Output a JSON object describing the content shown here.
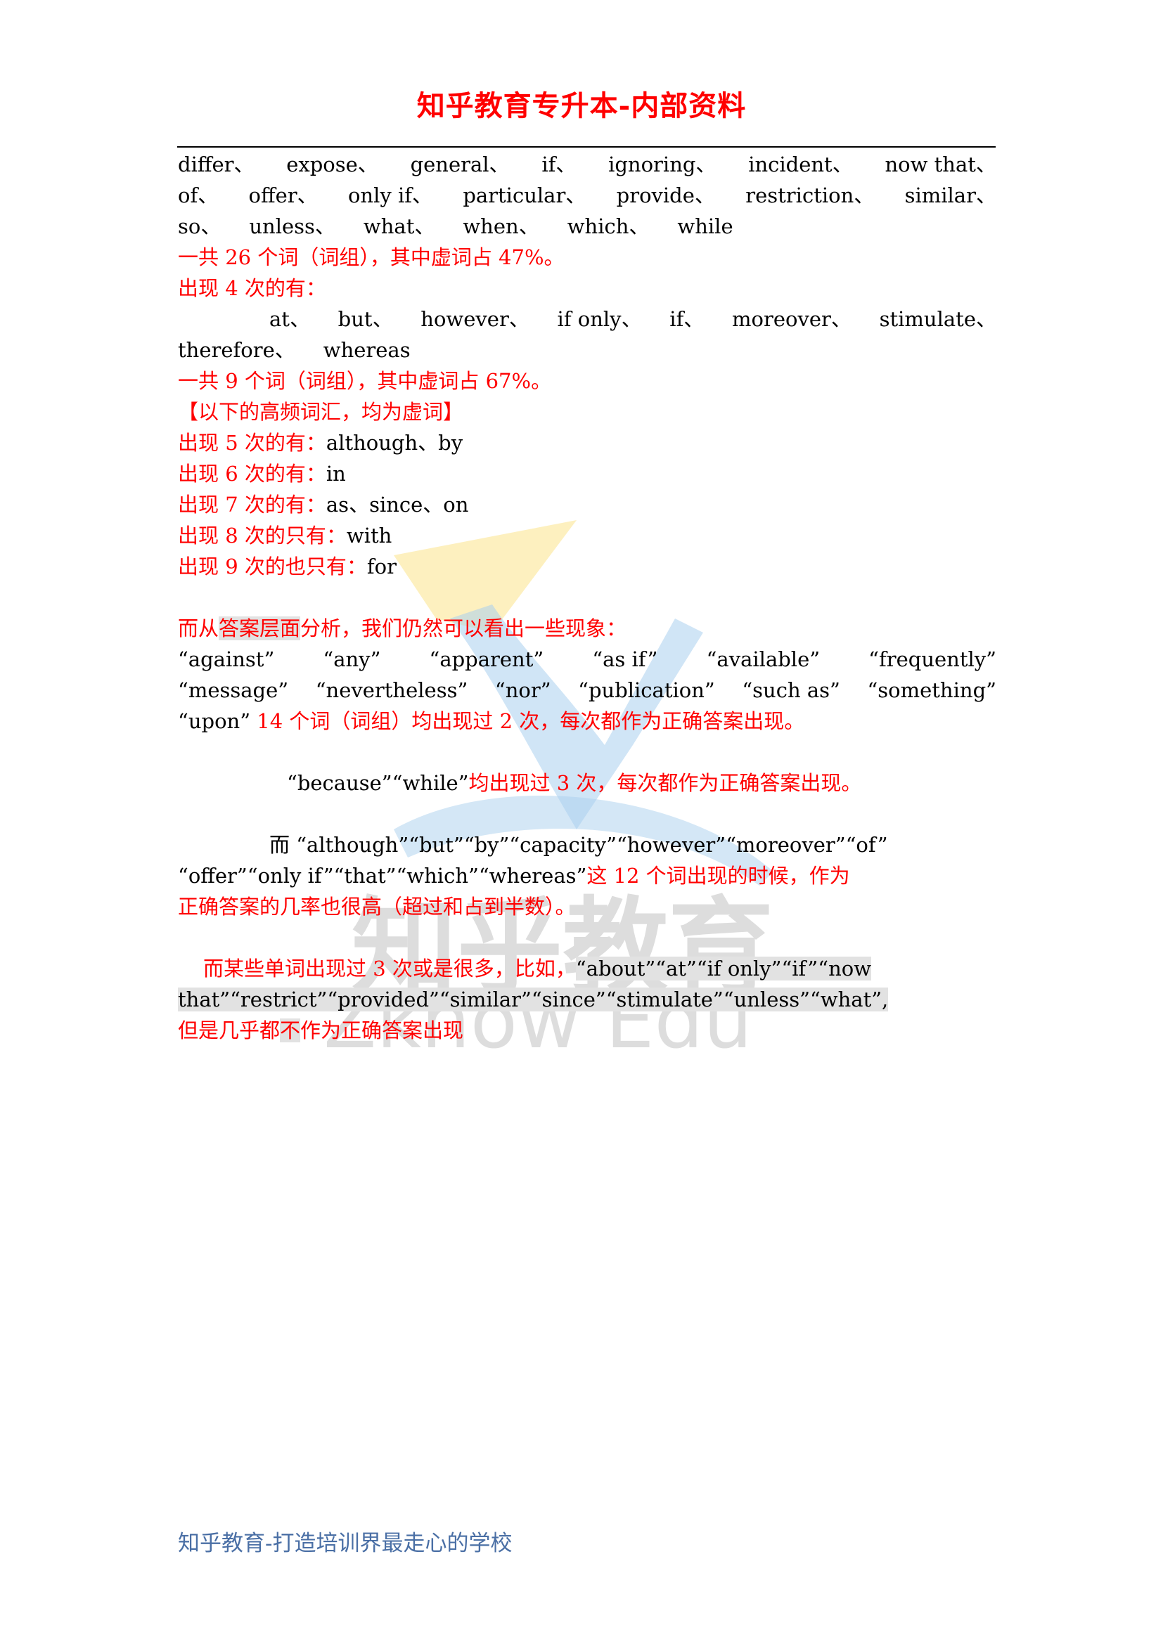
{
  "header": {
    "title": "知乎教育专升本-内部资料"
  },
  "section1": {
    "words_line1": [
      "differ、",
      "expose、",
      "general、",
      "if、",
      "ignoring、",
      "incident、",
      "now that、"
    ],
    "words_line2": [
      "of、",
      "offer、",
      "only if、",
      "particular、",
      "provide、",
      "restriction、",
      "similar、"
    ],
    "words_line3": [
      "so、",
      "unless、",
      "what、",
      "when、",
      "which、",
      "while"
    ],
    "summary": "一共 26 个词（词组），其中虚词占 47%。"
  },
  "section2": {
    "heading": "出现 4 次的有：",
    "words_line1": [
      "at、",
      "but、",
      "however、",
      "if only、",
      "if、",
      "moreover、",
      "stimulate、"
    ],
    "words_line2": [
      "therefore、",
      "whereas"
    ],
    "summary": "一共 9 个词（词组），其中虚词占 67%。"
  },
  "high_freq": {
    "heading": "【以下的高频词汇，均为虚词】",
    "rows": [
      {
        "label": "出现 5 次的有：",
        "words": "although、by"
      },
      {
        "label": "出现 6 次的有：",
        "words": "in"
      },
      {
        "label": "出现 7 次的有：",
        "words": "as、since、on"
      },
      {
        "label": "出现 8 次的只有：",
        "words": "with"
      },
      {
        "label": "出现 9 次的也只有：",
        "words": "for"
      }
    ]
  },
  "analysis": {
    "intro_pre": "而从",
    "intro_hl": "答案层面",
    "intro_post": "分析，我们仍然可以看出一些现象：",
    "twice_line1": [
      "“against”",
      "“any”",
      "“apparent”",
      "“as if”",
      "“available”",
      "“frequently”"
    ],
    "twice_line2": [
      "“message”",
      "“nevertheless”",
      "“nor”",
      "“publication”",
      "“such as”",
      "“something”"
    ],
    "twice_line3_word": "“upon”",
    "twice_line3_note": "14 个词（词组）均出现过 2 次，每次都作为正确答案出现。",
    "thrice_words": "“because”“while”",
    "thrice_note": "均出现过 3 次，每次都作为正确答案出现。",
    "high_lead": "而",
    "high_line1_words": "“although”“but”“by”“capacity”“however”“moreover”“of”",
    "high_line2_words": "“offer”“only if”“that”“which”“whereas”",
    "high_line2_note": "这 12 个词出现的时候，作为",
    "high_line3_note": "正确答案的几率也很高（超过和占到半数）。",
    "rare_intro": "而某些单词出现过 3 次或是很多，比如，",
    "rare_line1_words": "“about”“at”“if only”“if”“now",
    "rare_line2_words": "that”“restrict”“provided”“similar”“since”“stimulate”“unless”“what”,",
    "rare_line3_a": "但是几乎都",
    "rare_line3_hl": "不",
    "rare_line3_b": "作为正确答案出现"
  },
  "watermark": {
    "text_cn": "知乎教育",
    "text_en": "Zknow Edu",
    "colors": {
      "yellow": "#fbe48a",
      "blue": "#a9cfee",
      "gray": "#c8c8c8"
    }
  },
  "footer": {
    "text": "知乎教育-打造培训界最走心的学校"
  }
}
